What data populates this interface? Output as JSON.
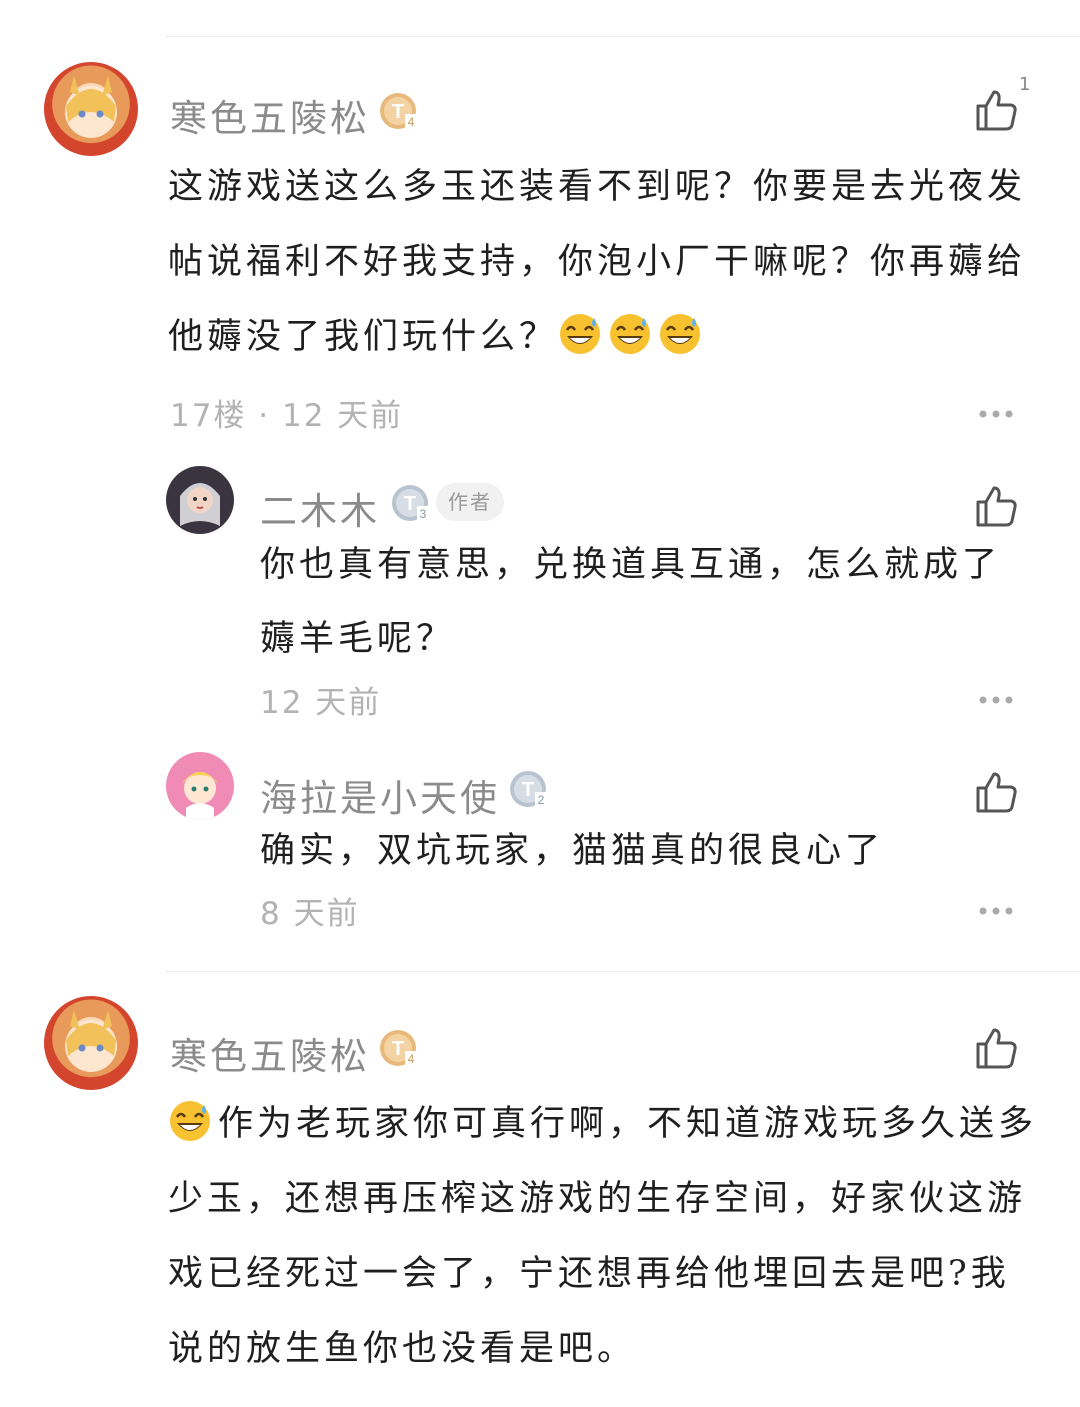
{
  "comments": [
    {
      "user": "寒色五陵松",
      "level": "4",
      "likes": "1",
      "text_lines": [
        "这游戏送这么多玉还装看不到呢？你要是去光夜发",
        "帖说福利不好我支持，你泡小厂干嘛呢？你再薅给",
        "他薅没了我们玩什么？"
      ],
      "meta": "17楼 · 12 天前",
      "replies": [
        {
          "user": "二木木",
          "level": "3",
          "author_tag": "作者",
          "text_lines": [
            "你也真有意思，兑换道具互通，怎么就成了",
            "薅羊毛呢？"
          ],
          "meta": "12 天前"
        },
        {
          "user": "海拉是小天使",
          "level": "2",
          "text_lines": [
            "确实，双坑玩家，猫猫真的很良心了"
          ],
          "meta": "8 天前"
        }
      ]
    },
    {
      "user": "寒色五陵松",
      "level": "4",
      "text_lines": [
        "作为老玩家你可真行啊，不知道游戏玩多久送多",
        "少玉，还想再压榨这游戏的生存空间，好家伙这游",
        "戏已经死过一会了，宁还想再给他埋回去是吧?我",
        "说的放生鱼你也没看是吧。"
      ]
    }
  ],
  "icons": {
    "like": "thumbs-up-icon",
    "more": "more-dots-icon",
    "emoji": "sweat-smile-emoji"
  },
  "colors": {
    "gold_badge": "#e8b97a",
    "silver_badge": "#b9c3cf"
  }
}
